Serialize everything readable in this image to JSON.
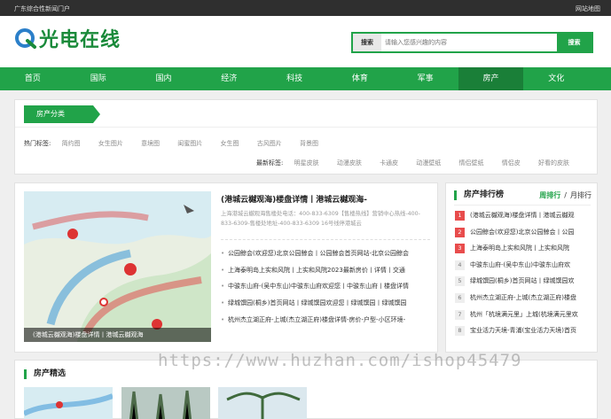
{
  "topbar": {
    "left": "广东综合性新闻门户",
    "right": "网站地图"
  },
  "logo": {
    "text": "光电在线"
  },
  "search": {
    "label": "搜索",
    "placeholder": "请输入您感兴趣的内容",
    "button": "搜索"
  },
  "nav": [
    "首页",
    "国际",
    "国内",
    "经济",
    "科技",
    "体育",
    "军事",
    "房产",
    "文化"
  ],
  "nav_active": "房产",
  "category": {
    "title": "房产分类",
    "hot_label": "热门标签:",
    "hot_tags": [
      "简约图",
      "女生图片",
      "意境图",
      "闺蜜图片",
      "女生图",
      "古风图片",
      "背景图"
    ],
    "new_label": "最新标签:",
    "new_tags": [
      "明星皮肤",
      "动漫皮肤",
      "卡通皮",
      "动漫壁纸",
      "情侣壁纸",
      "情侣皮",
      "好看的皮肤"
    ]
  },
  "featured": {
    "caption": "(港城云樾观海)楼盘详情丨港城云樾观海",
    "headline": "(港城云樾观海)楼盘详情丨港城云樾观海-",
    "subtext": "上海港城云樾观海售楼处电话：400-833-6309【售楼热线】营销中心热线-400-833-6309-售楼处地址-400-833-6309 16号线停港城云",
    "news": [
      "公园鲸会(欢迎您)北京公园鲸会丨公园鲸会首页网站-北京公园鲸会",
      "上海泰明岛上实和风院丨上实和风院2023最新房价丨详情丨交通",
      "中骏东山府-(吴中东山)中骏东山府欢迎您丨中骏东山府丨楼盘详情",
      "绿城馔园(桐乡)首页网站丨绿城馔园欢迎您丨绿城馔园丨绿城馔园",
      "杭州杰立湖正府-上城(杰立湖正府)楼盘详情-房价-户型-小区环境-"
    ]
  },
  "ranking": {
    "title": "房产排行榜",
    "tab_week": "周排行",
    "tab_month": "月排行",
    "items": [
      {
        "n": "1",
        "text": "(港城云樾观海)楼盘详情丨港城云樾观"
      },
      {
        "n": "2",
        "text": "公园鲸会(欢迎您)北京公园鲸会丨公园"
      },
      {
        "n": "3",
        "text": "上海泰明岛上实和风院丨上实和风院"
      },
      {
        "n": "4",
        "text": "中骏东山府-(吴中东山)中骏东山府欢"
      },
      {
        "n": "5",
        "text": "绿城馔园(桐乡)首页网站丨绿城馔园欢"
      },
      {
        "n": "6",
        "text": "杭州杰立湖正府-上城(杰立湖正府)楼盘"
      },
      {
        "n": "7",
        "text": "杭州「杭境满元里」上城(杭境满元里欢"
      },
      {
        "n": "8",
        "text": "宝业活力天境-青浦(宝业活力天境)首页"
      }
    ]
  },
  "picks": {
    "title": "房产精选"
  },
  "watermark": "https://www.huzhan.com/ishop45479",
  "colors": {
    "brand": "#21a349",
    "nav_active": "#1a7f38",
    "hot_rank": "#e84c4c"
  }
}
